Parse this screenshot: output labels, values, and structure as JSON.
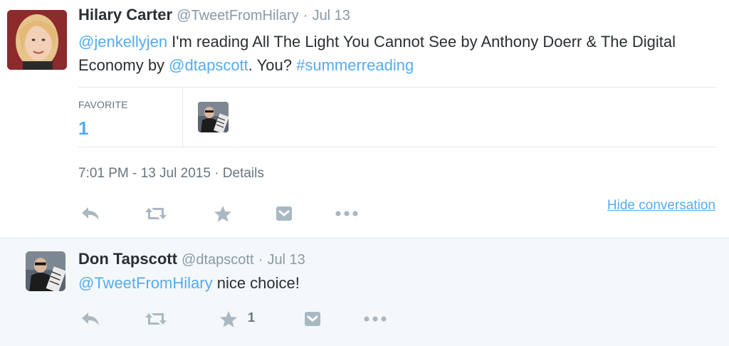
{
  "main_tweet": {
    "fullname": "Hilary Carter",
    "handle": "@TweetFromHilary",
    "separator": "·",
    "date": "Jul 13",
    "text_parts": {
      "mention": "@jenkellyjen",
      "body1": " I'm reading All The Light You Cannot See by Anthony Doerr & The Digital Economy by ",
      "mention2": "@dtapscott",
      "body2": ". You? ",
      "hashtag": "#summerreading"
    },
    "stats": {
      "favorite_label": "FAVORITE",
      "favorite_count": "1"
    },
    "timestamp": "7:01 PM - 13 Jul 2015",
    "meta_separator": "·",
    "details_label": "Details",
    "hide_conversation_label": "Hide conversation",
    "actions": [
      "reply-icon",
      "retweet-icon",
      "favorite-icon",
      "pocket-icon",
      "more-icon"
    ]
  },
  "reply_tweet": {
    "fullname": "Don Tapscott",
    "handle": "@dtapscott",
    "separator": "·",
    "date": "Jul 13",
    "text_parts": {
      "mention": "@TweetFromHilary",
      "body": " nice choice!"
    },
    "favorite_count": "1",
    "actions": [
      "reply-icon",
      "retweet-icon",
      "favorite-icon",
      "pocket-icon",
      "more-icon"
    ]
  },
  "colors": {
    "link": "#55acee",
    "text": "#292f33",
    "muted": "#8899a6",
    "icon": "#aab8c2",
    "reply_bg": "#f5f8fa"
  }
}
